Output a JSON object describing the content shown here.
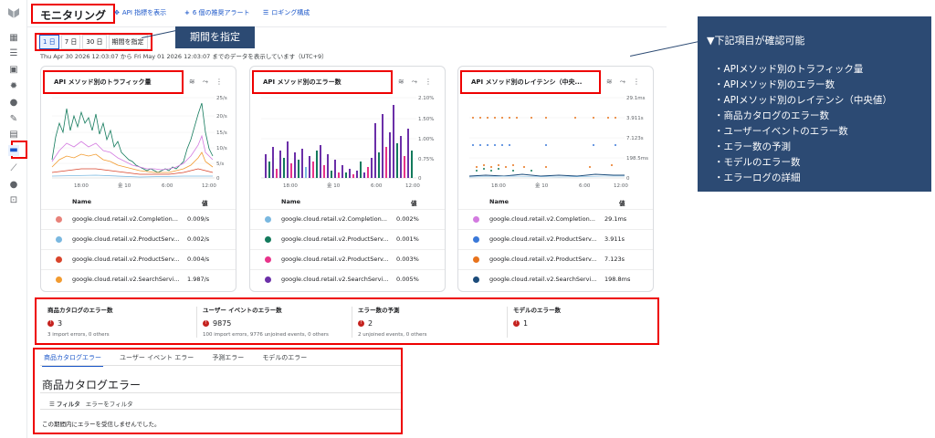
{
  "header": {
    "title": "モニタリング",
    "actions": [
      {
        "icon": "plus-cross-icon",
        "glyph": "✥",
        "label": "API 指標を表示"
      },
      {
        "icon": "plus-icon",
        "glyph": "+",
        "label": "6 個の推奨アラート"
      },
      {
        "icon": "list-icon",
        "glyph": "☰",
        "label": "ロギング構成"
      }
    ]
  },
  "time_range": {
    "options": [
      "1 日",
      "7 日",
      "30 日",
      "期間を指定"
    ],
    "selected": "1 日",
    "note": "Thu Apr 30 2026 12:03:07 から Fri May 01 2026 12:03:07 までのデータを表示しています（UTC+9）"
  },
  "callout": "期間を指定",
  "cards": [
    {
      "title": "API メソッド別のトラフィック量",
      "y_ticks": [
        "25/s",
        "20/s",
        "15/s",
        "10/s",
        "5/s",
        "0"
      ],
      "x_ticks": [
        "18:00",
        "金 10",
        "6:00",
        "12:00"
      ],
      "columns": {
        "name": "Name",
        "value": "値"
      },
      "rows": [
        {
          "name": "google.cloud.retail.v2.Completion...",
          "value": "0.009/s",
          "color": "#e8827a"
        },
        {
          "name": "google.cloud.retail.v2.ProductServ...",
          "value": "0.002/s",
          "color": "#7ab8e0"
        },
        {
          "name": "google.cloud.retail.v2.ProductServ...",
          "value": "0.004/s",
          "color": "#d9442b"
        },
        {
          "name": "google.cloud.retail.v2.SearchServi...",
          "value": "1.987/s",
          "color": "#f29b30"
        }
      ]
    },
    {
      "title": "API メソッド別のエラー数",
      "y_ticks": [
        "2.10%",
        "1.50%",
        "1.00%",
        "0.75%",
        "0"
      ],
      "x_ticks": [
        "18:00",
        "金 10",
        "6:00",
        "12:00"
      ],
      "columns": {
        "name": "Name",
        "value": "値"
      },
      "rows": [
        {
          "name": "google.cloud.retail.v2.Completion...",
          "value": "0.002%",
          "color": "#7ab8e0"
        },
        {
          "name": "google.cloud.retail.v2.ProductServ...",
          "value": "0.001%",
          "color": "#137a5c"
        },
        {
          "name": "google.cloud.retail.v2.ProductServ...",
          "value": "0.003%",
          "color": "#e8338a"
        },
        {
          "name": "google.cloud.retail.v2.SearchServi...",
          "value": "0.005%",
          "color": "#6b2fa8"
        }
      ]
    },
    {
      "title": "API メソッド別のレイテンシ（中央...",
      "y_ticks": [
        "29.1ms",
        "3.911s",
        "7.123s",
        "198.5ms",
        "0"
      ],
      "x_ticks": [
        "18:00",
        "金 10",
        "6:00",
        "12:00"
      ],
      "columns": {
        "name": "Name",
        "value": "値"
      },
      "rows": [
        {
          "name": "google.cloud.retail.v2.Completion...",
          "value": "29.1ms",
          "color": "#d37be0"
        },
        {
          "name": "google.cloud.retail.v2.ProductServ...",
          "value": "3.911s",
          "color": "#3a79d9"
        },
        {
          "name": "google.cloud.retail.v2.ProductServ...",
          "value": "7.123s",
          "color": "#e8731c"
        },
        {
          "name": "google.cloud.retail.v2.SearchServi...",
          "value": "198.8ms",
          "color": "#1b4b7a"
        }
      ]
    }
  ],
  "summary": [
    {
      "label": "商品カタログのエラー数",
      "value": "3",
      "sub": "3 import errors, 0 others"
    },
    {
      "label": "ユーザー イベントのエラー数",
      "value": "9875",
      "sub": "100 import errors, 9776 unjoined events, 0 others"
    },
    {
      "label": "エラー数の予測",
      "value": "2",
      "sub": "2 unjoined events, 0 others"
    },
    {
      "label": "モデルのエラー数",
      "value": "1",
      "sub": ""
    }
  ],
  "errors": {
    "tabs": [
      "商品カタログエラー",
      "ユーザー イベント エラー",
      "予測エラー",
      "モデルのエラー"
    ],
    "active_tab": "商品カタログエラー",
    "title": "商品カタログエラー",
    "filter_label": "フィルタ",
    "filter_placeholder": "エラーをフィルタ",
    "empty": "この期間内にエラーを受信しませんでした。"
  },
  "info": {
    "heading": "▼下記項目が確認可能",
    "items": [
      "・APIメソッド別のトラフィック量",
      "・APIメソッド別のエラー数",
      "・APIメソッド別のレイテンシ（中央値）",
      "・商品カタログのエラー数",
      "・ユーザーイベントのエラー数",
      "・エラー数の予測",
      "・モデルのエラー数",
      "・エラーログの詳細"
    ]
  }
}
